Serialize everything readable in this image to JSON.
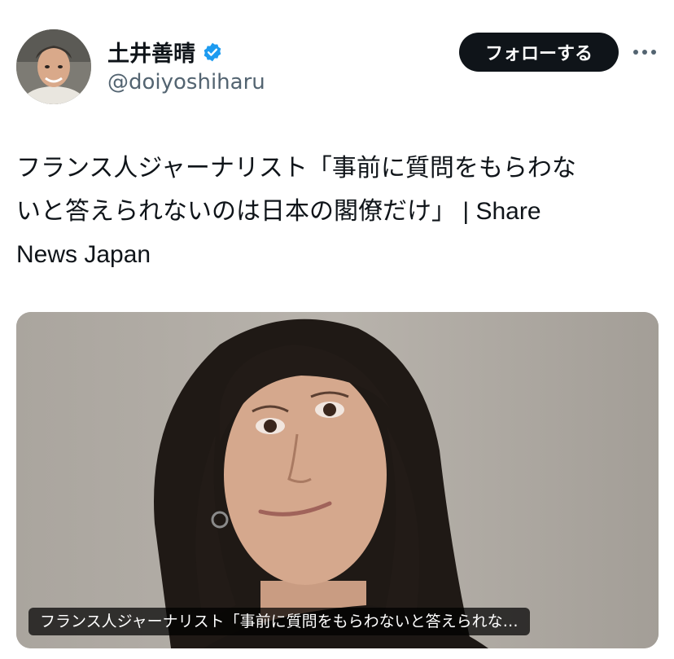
{
  "tweet": {
    "author": {
      "display_name": "土井善晴",
      "handle": "@doiyoshiharu",
      "verified": true,
      "verified_color": "#1d9bf0"
    },
    "follow_label": "フォローする",
    "more_icon": "more-dots-icon",
    "text_line1": "フランス人ジャーナリスト「事前に質問をもらわな",
    "text_line2": "いと答えられないのは日本の閣僚だけ」 | Share",
    "text_line3": "News Japan",
    "card": {
      "caption": "フランス人ジャーナリスト「事前に質問をもらわないと答えられな…"
    }
  },
  "colors": {
    "text": "#0f1419",
    "secondary": "#536471",
    "button_bg": "#0f1419",
    "button_text": "#ffffff"
  }
}
